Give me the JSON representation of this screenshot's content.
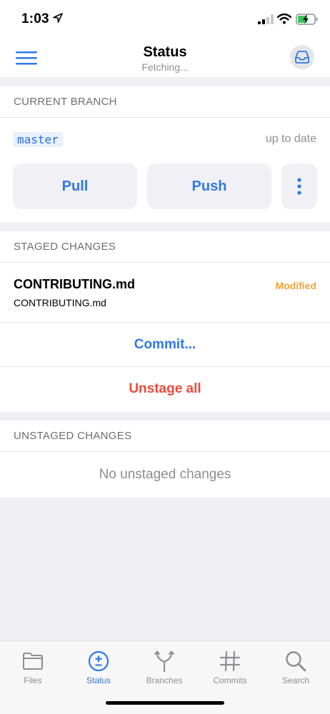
{
  "status_bar": {
    "time": "1:03"
  },
  "nav": {
    "title": "Status",
    "subtitle": "Fetching..."
  },
  "branch_section": {
    "header": "CURRENT BRANCH",
    "branch_name": "master",
    "sync_status": "up to date",
    "pull_label": "Pull",
    "push_label": "Push"
  },
  "staged_section": {
    "header": "STAGED CHANGES",
    "files": [
      {
        "name": "CONTRIBUTING.md",
        "path": "CONTRIBUTING.md",
        "status": "Modified"
      }
    ],
    "commit_label": "Commit...",
    "unstage_label": "Unstage all"
  },
  "unstaged_section": {
    "header": "UNSTAGED CHANGES",
    "empty_text": "No unstaged changes"
  },
  "tabs": [
    {
      "label": "Files",
      "icon": "folder-icon",
      "active": false
    },
    {
      "label": "Status",
      "icon": "plus-minus-circle-icon",
      "active": true
    },
    {
      "label": "Branches",
      "icon": "branch-fork-icon",
      "active": false
    },
    {
      "label": "Commits",
      "icon": "hash-icon",
      "active": false
    },
    {
      "label": "Search",
      "icon": "search-icon",
      "active": false
    }
  ],
  "colors": {
    "accent": "#2f79e6",
    "danger": "#e74c3c",
    "modified": "#f5a23a",
    "background": "#efeff4"
  }
}
